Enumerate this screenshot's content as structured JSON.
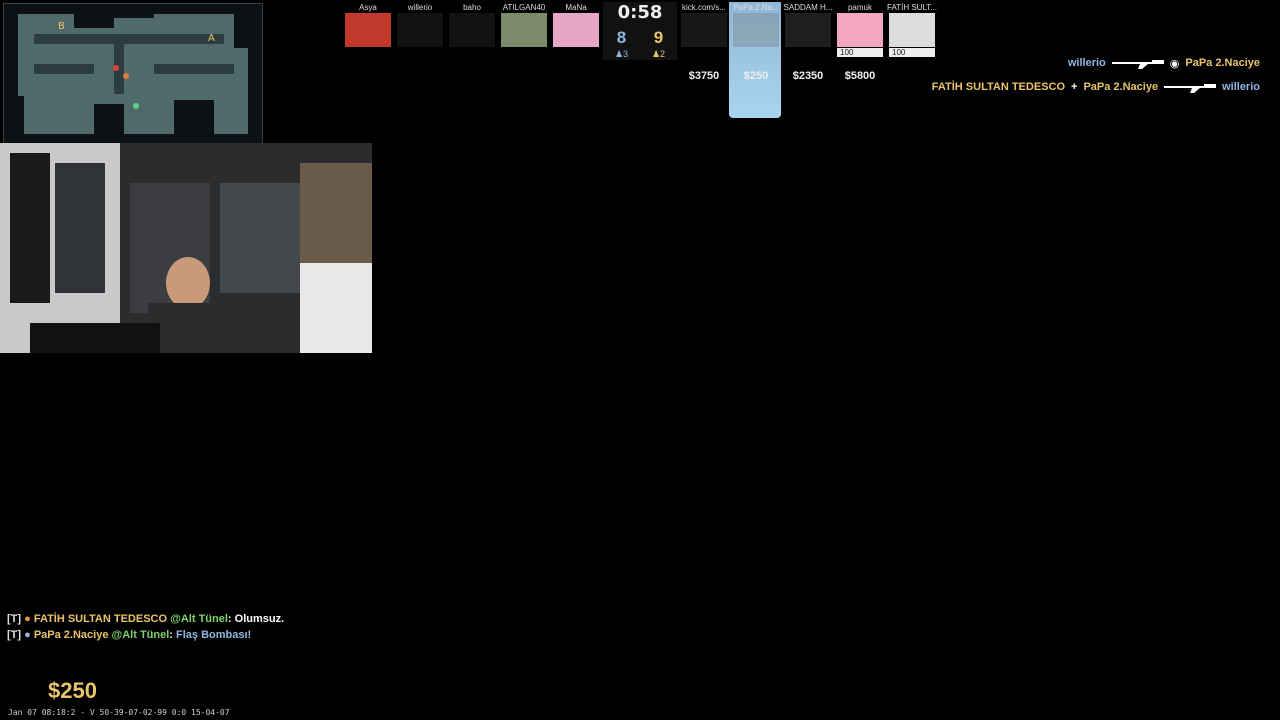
{
  "hud": {
    "timer": "0:58",
    "score_ct": "8",
    "score_t": "9",
    "alive_ct": "♟3",
    "alive_t": "♟2",
    "money": "$250",
    "footer": "Jan 07 08:18:2 - V 50-39-07-02-99 0:0 15-04-07"
  },
  "ct_players": [
    {
      "name": "Asya",
      "avatar_color": "#c0392b",
      "dead": false
    },
    {
      "name": "willerio",
      "avatar_color": "#333333",
      "dead": true
    },
    {
      "name": "baho",
      "avatar_color": "#333333",
      "dead": true
    },
    {
      "name": "ATILGAN40",
      "avatar_color": "#7a8a6a",
      "dead": false
    },
    {
      "name": "MaNa",
      "avatar_color": "#e6a6c6",
      "dead": false
    }
  ],
  "t_players": [
    {
      "name": "kick.com/s...",
      "money": "$3750",
      "avatar_color": "#444444",
      "dead": true
    },
    {
      "name": "PaPa 2.Na...",
      "money": "$250",
      "avatar_color": "#777777",
      "dead": true
    },
    {
      "name": "SADDAM H...",
      "money": "$2350",
      "avatar_color": "#555555",
      "dead": true
    },
    {
      "name": "pamuk",
      "money": "$5800",
      "hp": "100",
      "avatar_color": "#f4a7c3",
      "dead": false
    },
    {
      "name": "FATİH SULT...",
      "hp": "100",
      "avatar_color": "#dddddd",
      "dead": false
    }
  ],
  "killfeed": [
    {
      "killer": "willerio",
      "victim": "PaPa 2.Naciye",
      "killer_team": "ct",
      "victim_team": "t"
    },
    {
      "killer": "FATİH SULTAN TEDESCO",
      "plus": "+",
      "assister": "PaPa 2.Naciye",
      "victim": "willerio",
      "killer_team": "t",
      "victim_team": "ct"
    }
  ],
  "chat": [
    {
      "tag": "[T]",
      "name": "FATİH SULTAN TEDESCO",
      "location": "@Alt Tünel",
      "message": "Olumsuz."
    },
    {
      "tag": "[T]",
      "name": "PaPa 2.Naciye",
      "location": "@Alt Tünel",
      "message": "Flaş Bombası!"
    }
  ],
  "radar": {
    "labels": [
      "B",
      "A"
    ]
  },
  "colors": {
    "ct": "#8fb7e0",
    "t": "#e8c46a",
    "location": "#7ed36a"
  }
}
